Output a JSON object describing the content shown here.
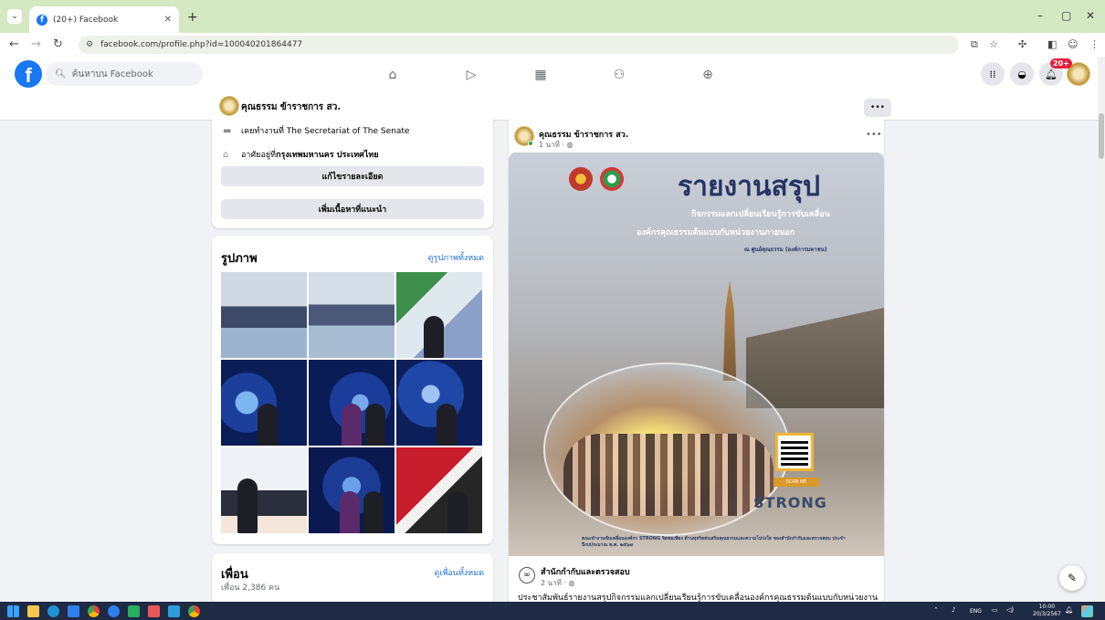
{
  "browser": {
    "tab_title": "(20+) Facebook",
    "url": "facebook.com/profile.php?id=100040201864477"
  },
  "fb": {
    "logo": "f",
    "search_placeholder": "ค้นหาบน Facebook",
    "notification_count": "20+",
    "nav_icons": [
      "home-icon",
      "video-icon",
      "marketplace-icon",
      "groups-icon",
      "gaming-icon"
    ]
  },
  "profile": {
    "name": "คุณธรรม ข้าราชการ สว.",
    "more_label": "•••"
  },
  "intro": {
    "worked_at": "เคยทำงานที่ The Secretariat of The Senate",
    "lives_prefix": "อาศัยอยู่ที่ ",
    "lives_city": "กรุงเทพมหานคร ประเทศไทย",
    "edit_details": "แก้ไขรายละเอียด",
    "add_featured": "เพิ่มเนื้อหาที่แนะนำ"
  },
  "photos": {
    "title": "รูปภาพ",
    "see_all": "ดูรูปภาพทั้งหมด"
  },
  "friends": {
    "title": "เพื่อน",
    "see_all": "ดูเพื่อนทั้งหมด",
    "count": "เพื่อน 2,386 คน"
  },
  "post": {
    "author": "คุณธรรม ข้าราชการ สว.",
    "time": "1 นาที · ◍",
    "more": "•••",
    "poster": {
      "title": "รายงานสรุป",
      "line1": "กิจกรรมแลกเปลี่ยนเรียนรู้การขับเคลื่อน",
      "line2": "องค์กรคุณธรรมต้นแบบกับหน่วยงานภายนอก",
      "line3": "ณ ศูนย์คุณธรรม (องค์การมหาชน)",
      "scan_label": "SCAN ME",
      "strong": "STRONG",
      "footer": "คณะทำงานขับเคลื่อนองค์กร STRONG จิตพอเพียง ต้านทุจริตส่งเสริมคุณธรรมและความโปร่งใส ของสำนักกำกับและตรวจสอบ ประจำปีงบประมาณ พ.ศ. ๒๕๖๗"
    },
    "shared": {
      "name": "สำนักกำกับและตรวจสอบ",
      "time": "2 นาที · ◍",
      "text": "ประชาสัมพันธ์รายงานสรุปกิจกรรมแลกเปลี่ยนเรียนรู้การขับเคลื่อนองค์กรคุณธรรมต้นแบบกับหน่วยงาน"
    }
  },
  "taskbar": {
    "lang": "ENG",
    "time": "10:00",
    "date": "20/3/2567"
  }
}
